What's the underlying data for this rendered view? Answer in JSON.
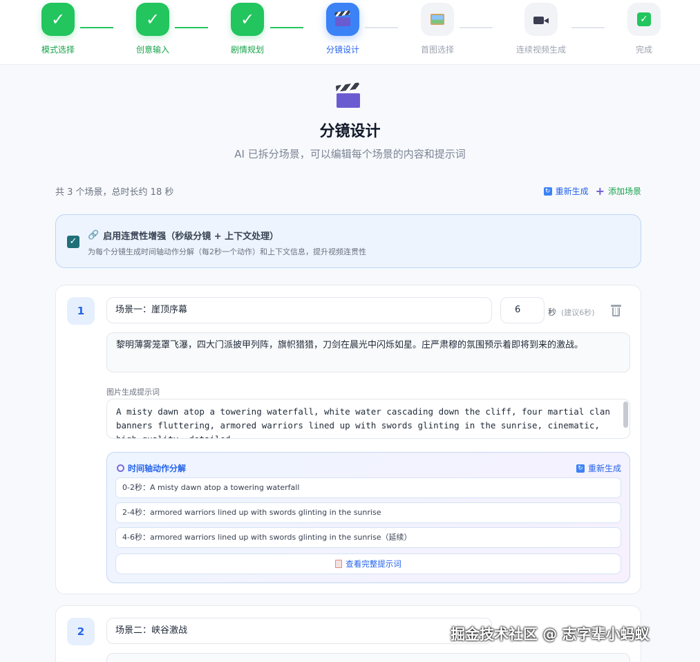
{
  "stepper": {
    "steps": [
      {
        "label": "模式选择",
        "state": "done",
        "icon": "check-icon"
      },
      {
        "label": "创意输入",
        "state": "done",
        "icon": "check-icon"
      },
      {
        "label": "剧情规划",
        "state": "done",
        "icon": "check-icon"
      },
      {
        "label": "分镜设计",
        "state": "active",
        "icon": "clapperboard-icon"
      },
      {
        "label": "首图选择",
        "state": "todo",
        "icon": "picture-icon"
      },
      {
        "label": "连续视频生成",
        "state": "todo",
        "icon": "movie-camera-icon"
      },
      {
        "label": "完成",
        "state": "todo",
        "icon": "check-box-icon"
      }
    ],
    "check_glyph": "✓"
  },
  "header": {
    "title": "分镜设计",
    "subtitle": "AI 已拆分场景，可以编辑每个场景的内容和提示词"
  },
  "summary": "共 3 个场景，总时长约 18 秒",
  "actions": {
    "regenerate": "重新生成",
    "add_scene": "添加场景"
  },
  "consistency": {
    "checked": true,
    "check_glyph": "✓",
    "title": "启用连贯性增强（秒级分镜 + 上下文处理）",
    "description": "为每个分镜生成时间轴动作分解（每2秒一个动作）和上下文信息，提升视频连贯性"
  },
  "scenes": [
    {
      "number": "1",
      "title": "场景一：崖顶序幕",
      "duration": "6",
      "duration_unit": "秒",
      "duration_hint": "(建议6秒)",
      "description": "黎明薄雾笼罩飞瀑，四大门派披甲列阵，旗帜猎猎，刀剑在晨光中闪烁如星。庄严肃穆的氛围预示着即将到来的激战。",
      "prompt_label": "图片生成提示词",
      "prompt": "A misty dawn atop a towering waterfall, white water cascading down the cliff, four martial clan banners fluttering, armored warriors lined up with swords glinting in the sunrise, cinematic, high quality, detailed",
      "timeline": {
        "title": "时间轴动作分解",
        "regenerate": "重新生成",
        "items": [
          "0-2秒：A misty dawn atop a towering waterfall",
          "2-4秒：armored warriors lined up with swords glinting in the sunrise",
          "4-6秒：armored warriors lined up with swords glinting in the sunrise（延续）"
        ],
        "view_full": "查看完整提示词"
      }
    },
    {
      "number": "2",
      "title": "场景二：峡谷激战"
    }
  ],
  "watermark": "掘金技术社区 @ 志字辈小蚂蚁",
  "colors": {
    "done": "#22c55e",
    "active": "#3b82f6",
    "todo": "#f1f3f6",
    "accent_blue": "#2563eb"
  }
}
